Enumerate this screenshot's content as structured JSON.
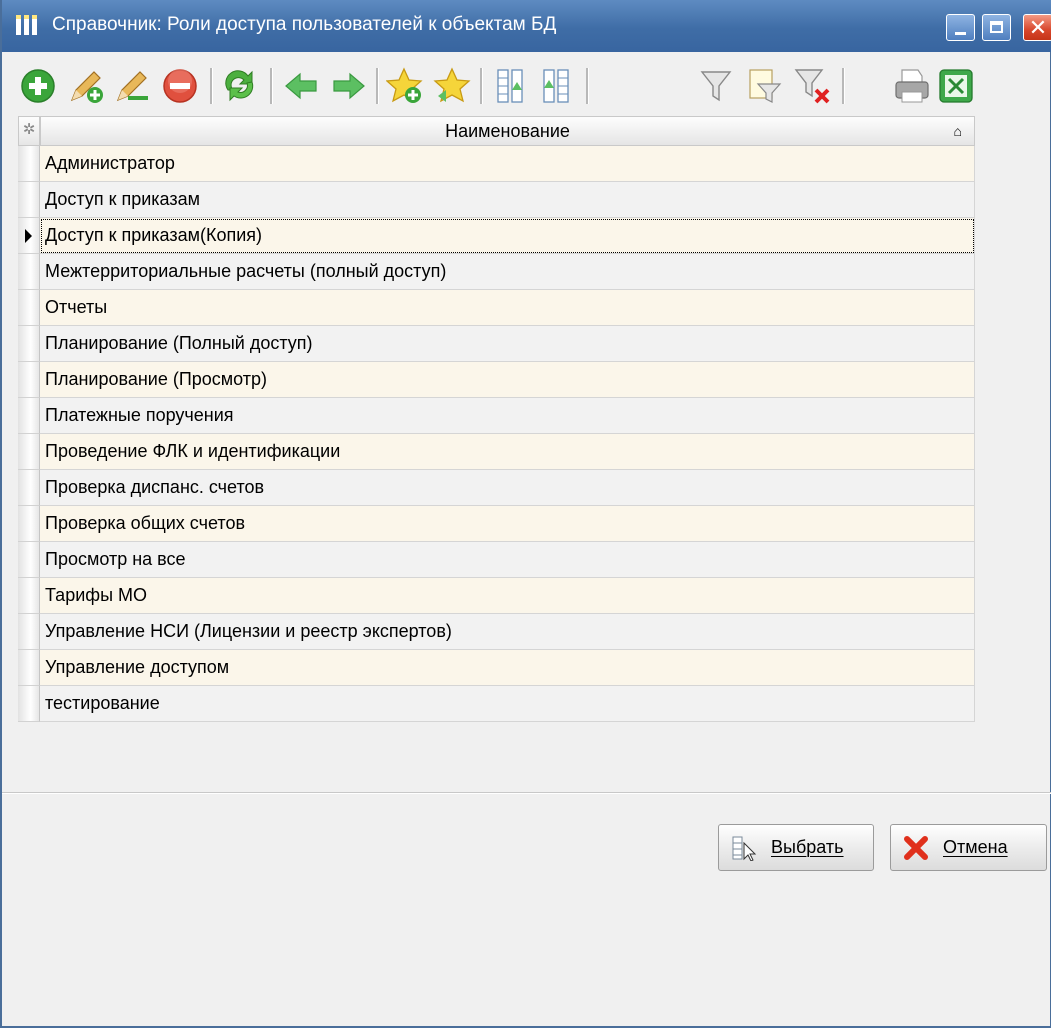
{
  "window": {
    "title": "Справочник: Роли доступа пользователей к объектам БД",
    "controls": {
      "minimize": "_",
      "maximize": "□",
      "close": "✕"
    }
  },
  "toolbar": {
    "icons": [
      "add-icon",
      "add-copy-icon",
      "edit-icon",
      "delete-icon",
      "refresh-icon",
      "back-icon",
      "forward-icon",
      "add-favorite-icon",
      "favorites-icon",
      "expand-columns-icon",
      "collapse-columns-icon",
      "filter-icon",
      "filter-edit-icon",
      "filter-clear-icon",
      "print-icon",
      "excel-export-icon"
    ]
  },
  "grid": {
    "corner_glyph": "✲",
    "column_header": "Наименование",
    "sort_glyph": "⌂",
    "selected_index": 2,
    "rows": [
      "Администратор",
      "Доступ к приказам",
      "Доступ к приказам(Копия)",
      "Межтерриториальные расчеты (полный доступ)",
      "Отчеты",
      "Планирование (Полный доступ)",
      "Планирование (Просмотр)",
      "Платежные поручения",
      "Проведение ФЛК и идентификации",
      "Проверка диспанс. счетов",
      "Проверка общих счетов",
      "Просмотр на все",
      "Тарифы МО",
      "Управление НСИ (Лицензии и реестр экспертов)",
      "Управление доступом",
      "тестирование"
    ]
  },
  "buttons": {
    "select_label": "Выбрать",
    "cancel_label": "Отмена"
  },
  "colors": {
    "titlebar": "#4a78b2",
    "row_odd": "#fbf6ea",
    "row_even": "#f2f2f2",
    "add_green": "#3aa53a",
    "delete_red": "#e0503e"
  }
}
